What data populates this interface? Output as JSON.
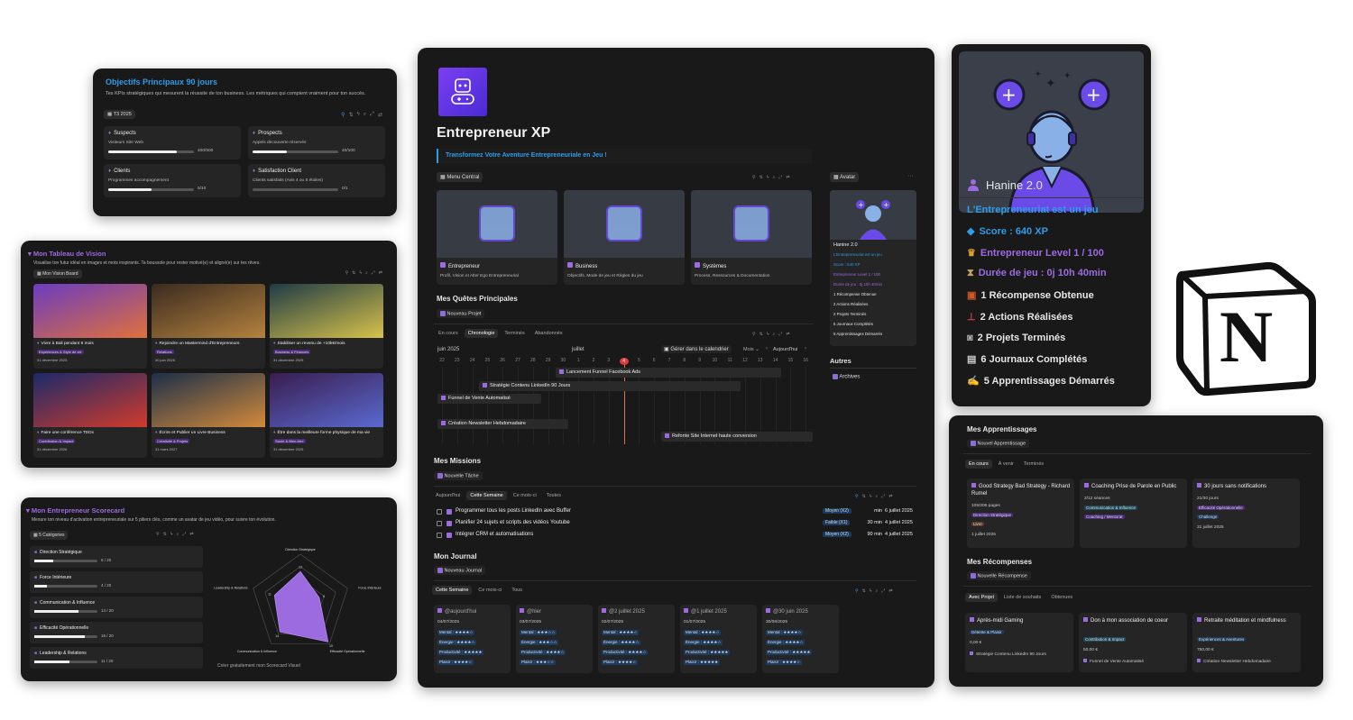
{
  "objectives": {
    "title": "Objectifs Principaux 90 jours",
    "description": "Tes KPIs stratégiques qui mesurent la réussite de ton business. Les métriques qui comptent vraiment pour ton succès.",
    "view": "T3 2025",
    "cards": [
      {
        "label": "Suspects",
        "sub": "Visiteurs Site Web",
        "value": "400/500",
        "progress": 0.8
      },
      {
        "label": "Prospects",
        "sub": "Appels découverte réservés",
        "value": "40/100",
        "progress": 0.4
      },
      {
        "label": "Clients",
        "sub": "Programmes accompagnement",
        "value": "5/10",
        "progress": 0.5
      },
      {
        "label": "Satisfaction Client",
        "sub": "Clients satisfaits (Avis 4 ou 5 étoiles)",
        "value": "0/1",
        "progress": 0.0
      }
    ]
  },
  "vision": {
    "title": "Mon Tableau de Vision",
    "description": "Visualise ton futur idéal en images et mots inspirants. Ta boussole pour rester motivé(e) et aligné(e) sur tes rêves.",
    "view": "Mon Vision Board",
    "items": [
      {
        "title": "Vivre à Bali pendant 6 mois",
        "tag": "Expériences & Style de vie",
        "date": "31 décembre 2025",
        "colors": [
          "#6a3cc0",
          "#e0703c"
        ]
      },
      {
        "title": "Rejoindre un Mastermind d'Entrepreneurs",
        "tag": "Relations",
        "date": "30 juin 2026",
        "colors": [
          "#3a2b1f",
          "#b5823f"
        ]
      },
      {
        "title": "Stabiliser un revenu de +10k€/mois",
        "tag": "Business & Finances",
        "date": "31 décembre 2025",
        "colors": [
          "#1f3b45",
          "#d7c24a"
        ]
      },
      {
        "title": "Faire une conférence TEDx",
        "tag": "Contribution & Impact",
        "date": "31 décembre 2026",
        "colors": [
          "#1b2a6b",
          "#d13b2b"
        ]
      },
      {
        "title": "Écrire et Publier un Livre Business",
        "tag": "Créativité & Projets",
        "date": "31 mars 2027",
        "colors": [
          "#1c2f4a",
          "#d28a3a"
        ]
      },
      {
        "title": "Être dans la meilleure forme physique de ma vie",
        "tag": "Santé & Bien-être",
        "date": "31 décembre 2025",
        "colors": [
          "#3a1d4f",
          "#5a6ad0"
        ]
      }
    ]
  },
  "scorecard": {
    "title": "Mon Entrepreneur Scorecard",
    "description": "Mesure ton niveau d'activation entrepreneuriale sur 5 piliers clés, comme un avatar de jeu vidéo, pour suivre ton évolution.",
    "view": "5 Catégories",
    "categories": [
      {
        "label": "Direction Stratégique",
        "value": "6 / 20",
        "score": 6
      },
      {
        "label": "Force Intérieure",
        "value": "4 / 20",
        "score": 4
      },
      {
        "label": "Communication & Influence",
        "value": "14 / 20",
        "score": 14
      },
      {
        "label": "Efficacité Opérationnelle",
        "value": "16 / 20",
        "score": 16
      },
      {
        "label": "Leadership & Relations",
        "value": "11 / 20",
        "score": 11
      }
    ],
    "radar_labels": [
      "Direction Stratégique",
      "Force Intérieure",
      "Efficacité Opérationnelle",
      "Communication & Influence",
      "Leadership & Relations"
    ],
    "radar_values": [
      "13",
      "8",
      "19",
      "14",
      "11"
    ],
    "footer": "Créer gratuitement mon Scorecard Visuel"
  },
  "main": {
    "title": "Entrepreneur XP",
    "subtitle": "Transformez Votre Aventure Entrepreneuriale en Jeu !",
    "menu_label": "Menu Central",
    "avatar_label": "Avatar",
    "menu_cards": [
      {
        "title": "Entrepreneur",
        "sub": "Profil, Vision et Alter Ego Entrepreneurial"
      },
      {
        "title": "Business",
        "sub": "Objectifs, Mode de jeu et Règles du jeu"
      },
      {
        "title": "Systèmes",
        "sub": "Process, Ressources & Documentation"
      }
    ],
    "avatar_card": {
      "name": "Hanine 2.0",
      "lines": [
        "L'Entrepreneuriat est un jeu",
        "Score : 640 XP",
        "Entrepreneur Level 1 / 100",
        "Durée de jeu : 0j 10h 40min",
        "1 Récompense Obtenue",
        "2 Actions Réalisées",
        "2 Projets Terminés",
        "6 Journaux Complétés",
        "5 Apprentissages Démarrés"
      ]
    },
    "others_title": "Autres",
    "archives": "Archives",
    "quests": {
      "title": "Mes Quêtes Principales",
      "new": "Nouveau Projet",
      "tabs": [
        "En cours",
        "Chronologie",
        "Terminés",
        "Abandonnés"
      ],
      "active_tab": 1,
      "month1": "juin 2025",
      "month2": "juillet",
      "manage": "Gérer dans le calendrier",
      "mode": "Mois",
      "today": "Aujourd'hui",
      "days": [
        "22",
        "23",
        "24",
        "25",
        "26",
        "27",
        "28",
        "29",
        "30",
        "1",
        "2",
        "3",
        "4",
        "5",
        "6",
        "7",
        "8",
        "9",
        "10",
        "11",
        "12",
        "13",
        "14",
        "15",
        "16",
        "17",
        "18",
        "19",
        "20",
        "21",
        "22",
        "23"
      ],
      "today_index": 12,
      "bars": [
        {
          "label": "Lancement Funnel Facebook Ads"
        },
        {
          "label": "Stratégie Contenu LinkedIn 90 Jours"
        },
        {
          "label": "Funnel de Vente Automatisé"
        },
        {
          "label": "Création Newsletter Hebdomadaire"
        },
        {
          "label": "Refonte Site Internet haute conversion"
        }
      ]
    },
    "missions": {
      "title": "Mes Missions",
      "new": "Nouvelle Tâche",
      "tabs": [
        "Aujourd'hui",
        "Cette Semaine",
        "Ce mois-ci",
        "Toutes"
      ],
      "active_tab": 1,
      "rows": [
        {
          "label": "Programmer tous les posts LinkedIn avec Buffer",
          "tag": "Moyen (X2)",
          "dur": "min",
          "date": "6 juillet 2025"
        },
        {
          "label": "Planifier 24 sujets et scripts des vidéos Youtube",
          "tag": "Faible (X1)",
          "dur": "30 min",
          "date": "4 juillet 2025"
        },
        {
          "label": "Intégrer CRM et automatisations",
          "tag": "Moyen (X2)",
          "dur": "90 min",
          "date": "4 juillet 2025"
        }
      ]
    },
    "journal": {
      "title": "Mon Journal",
      "new": "Nouveau Journal",
      "tabs": [
        "Cette Semaine",
        "Ce mois-ci",
        "Tous"
      ],
      "active_tab": 0,
      "entries": [
        {
          "title": "@aujourd'hui",
          "date": "04/07/2025",
          "rows": [
            "Mental : ★★★★☆",
            "Énergie : ★★★★☆",
            "Productivité : ★★★★★",
            "Plaisir : ★★★★☆"
          ]
        },
        {
          "title": "@hier",
          "date": "03/07/2025",
          "rows": [
            "Mental : ★★★☆☆",
            "Énergie : ★★★☆☆",
            "Productivité : ★★★★☆",
            "Plaisir : ★★★☆☆"
          ]
        },
        {
          "title": "@2 juillet 2025",
          "date": "02/07/2025",
          "rows": [
            "Mental : ★★★★☆",
            "Énergie : ★★★★☆",
            "Productivité : ★★★★☆",
            "Plaisir : ★★★★☆"
          ]
        },
        {
          "title": "@1 juillet 2025",
          "date": "01/07/2025",
          "rows": [
            "Mental : ★★★★☆",
            "Énergie : ★★★★☆",
            "Productivité : ★★★★★",
            "Plaisir : ★★★★★"
          ]
        },
        {
          "title": "@30 juin 2025",
          "date": "30/06/2025",
          "rows": [
            "Mental : ★★★★☆",
            "Énergie : ★★★★☆",
            "Productivité : ★★★★★",
            "Plaisir : ★★★★☆"
          ]
        }
      ]
    }
  },
  "avatar_panel": {
    "name": "Hanine 2.0",
    "tagline": "L'Entrepreneuriat est un jeu",
    "stats": [
      {
        "icon": "gem-icon",
        "text": "Score : 640 XP",
        "color": "#2f9ce8"
      },
      {
        "icon": "trophy-icon",
        "text": "Entrepreneur Level 1 / 100",
        "color": "#9b6bdf"
      },
      {
        "icon": "hourglass-icon",
        "text": "Durée de jeu : 0j 10h 40min",
        "color": "#9b6bdf"
      },
      {
        "icon": "gift-icon",
        "text": "1 Récompense Obtenue",
        "color": "#e6e6e6"
      },
      {
        "icon": "joystick-icon",
        "text": "2 Actions Réalisées",
        "color": "#e6e6e6"
      },
      {
        "icon": "gamepad-icon",
        "text": "2 Projets Terminés",
        "color": "#e6e6e6"
      },
      {
        "icon": "calendar-icon",
        "text": "6 Journaux Complétés",
        "color": "#e6e6e6"
      },
      {
        "icon": "writing-hand-icon",
        "text": "5 Apprentissages Démarrés",
        "color": "#e6e6e6"
      }
    ]
  },
  "notion_logo": {
    "letter": "N"
  },
  "learning": {
    "title": "Mes Apprentissages",
    "new": "Nouvel Apprentissage",
    "tabs": [
      "En cours",
      "À venir",
      "Terminés"
    ],
    "active_tab": 0,
    "cards": [
      {
        "title": "Good Strategy Bad Strategy - Richard Rumel",
        "progress": "105/206 pages",
        "tags": [
          "Direction Stratégique",
          "Livre"
        ],
        "date": "1 juillet 2025"
      },
      {
        "title": "Coaching Prise de Parole en Public",
        "progress": "2/12 séances",
        "tags": [
          "Communication & Influence",
          "Coaching / Mentorat"
        ],
        "date": ""
      },
      {
        "title": "30 jours sans notifications",
        "progress": "21/30 jours",
        "tags": [
          "Efficacité Opérationnelle",
          "Challenge"
        ],
        "date": "31 juillet 2025"
      }
    ],
    "rewards_title": "Mes Récompenses",
    "rewards_new": "Nouvelle Récompense",
    "rewards_tabs": [
      "Avec Projet",
      "Liste de souhaits",
      "Obtenues"
    ],
    "rewards_active": 0,
    "rewards": [
      {
        "title": "Après-midi Gaming",
        "tag": "Détente & Plaisir",
        "amount": "0,00 €",
        "link": "Stratégie Contenu LinkedIn 90 Jours"
      },
      {
        "title": "Don à mon association de coeur",
        "tag": "Contribution & Impact",
        "amount": "50,00 €",
        "link": "Funnel de Vente Automatisé"
      },
      {
        "title": "Retraite méditation et mindfulness",
        "tag": "Expériences & Aventures",
        "amount": "750,00 €",
        "link": "Création Newsletter Hebdomadaire"
      }
    ]
  }
}
